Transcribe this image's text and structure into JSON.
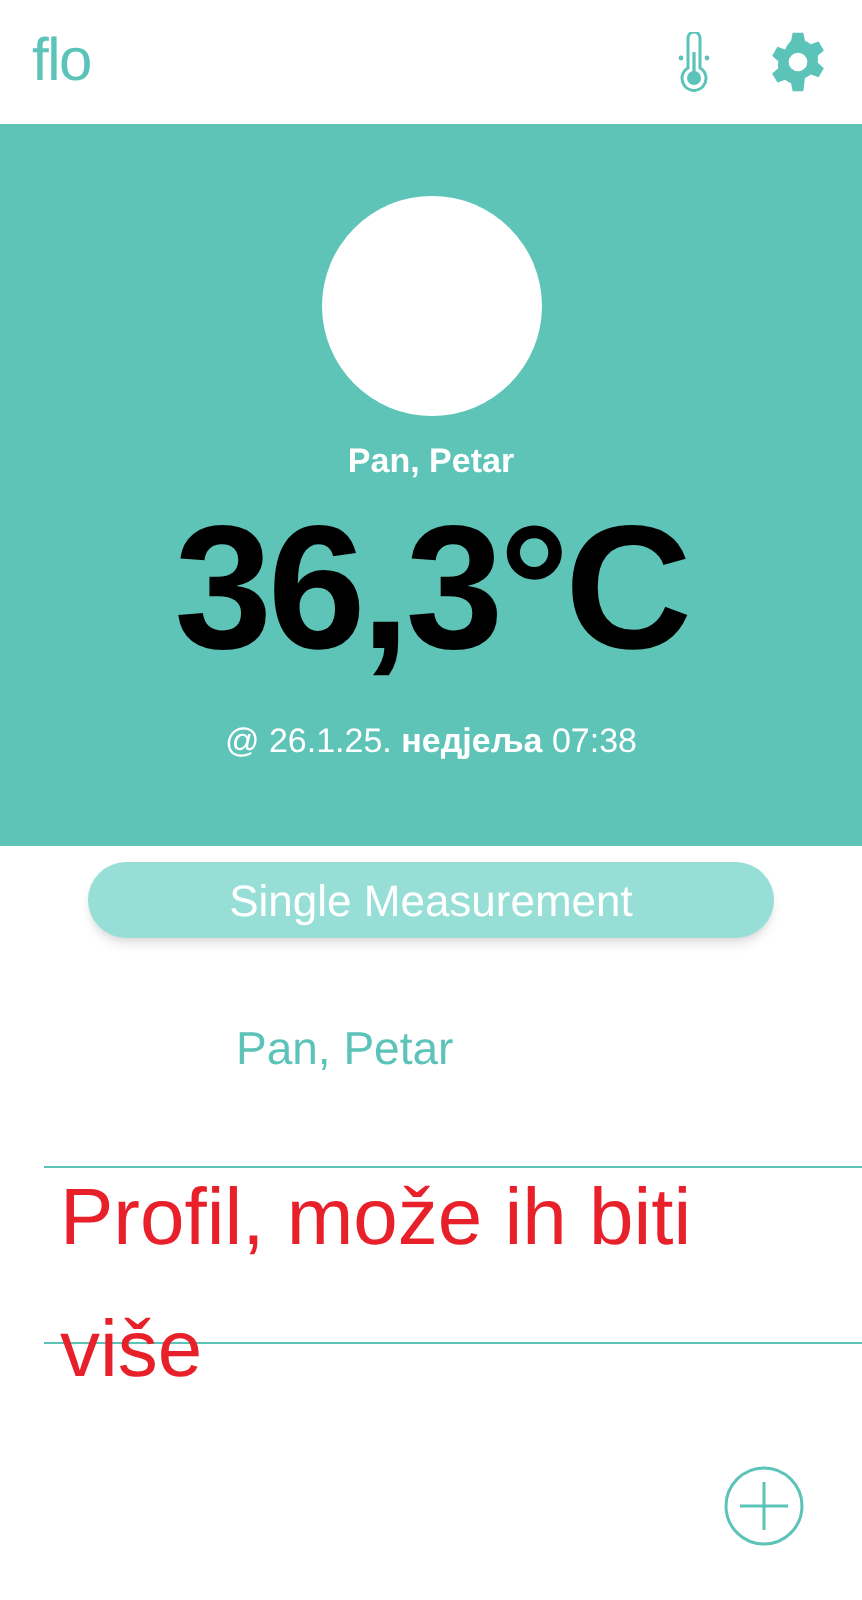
{
  "header": {
    "logo": "flo"
  },
  "current": {
    "name": "Pan, Petar",
    "temperature": "36,3°C",
    "timestamp": "@ 26.1.25. **недјеља** 07:38"
  },
  "mode_button": {
    "label": "Single Measurement"
  },
  "profiles": [
    {
      "name": "Pan, Petar"
    }
  ],
  "annotation": {
    "text": "Profil, može ih biti više"
  }
}
